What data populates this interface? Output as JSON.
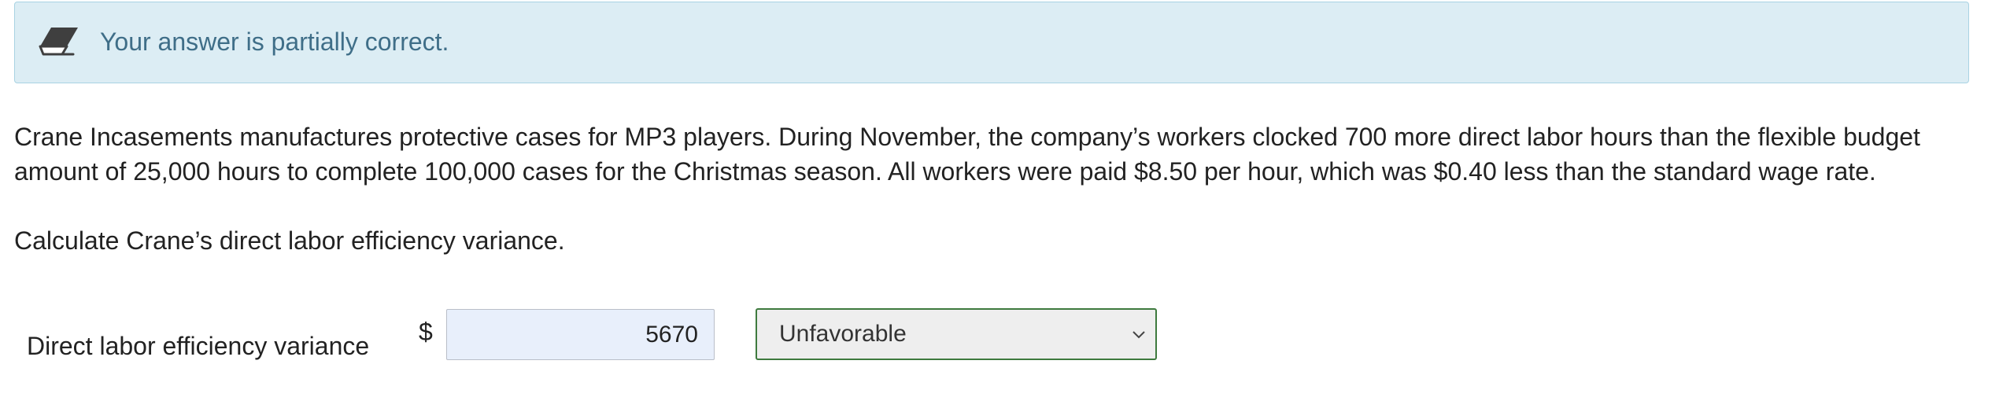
{
  "banner": {
    "message": "Your answer is partially correct.",
    "icon": "eraser-icon",
    "background": "#dcedf4",
    "text_color": "#3f6e88"
  },
  "question": {
    "text": "Crane Incasements manufactures protective cases for MP3 players. During November, the company’s workers clocked 700 more direct labor hours than the flexible budget amount of 25,000 hours to complete 100,000 cases for the Christmas season. All workers were paid $8.50 per hour, which was $0.40 less than the standard wage rate.",
    "prompt": "Calculate Crane’s direct labor efficiency variance."
  },
  "answer_row": {
    "label": "Direct labor efficiency variance",
    "currency": "$",
    "amount_value": "5670",
    "select_value": "Unfavorable",
    "select_border_color": "#3e7a3e"
  }
}
